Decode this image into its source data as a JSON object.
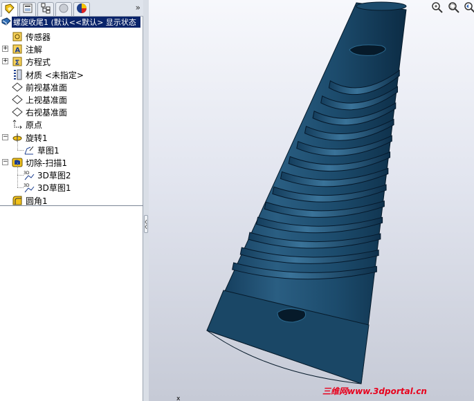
{
  "panel": {
    "tabs": [
      {
        "icon": "feature-manager-icon",
        "active": true
      },
      {
        "icon": "property-manager-icon",
        "active": false
      },
      {
        "icon": "configuration-manager-icon",
        "active": false
      },
      {
        "icon": "dimxpert-manager-icon",
        "active": false
      },
      {
        "icon": "display-manager-icon",
        "active": false
      }
    ],
    "more_glyph": "»",
    "root_label": "螺旋收尾1  (默认<<默认> 显示状态",
    "tree": [
      {
        "label": "传感器",
        "icon": "sensors-icon",
        "expandable": false
      },
      {
        "label": "注解",
        "icon": "annotations-icon",
        "expandable": true,
        "expander": "+"
      },
      {
        "label": "方程式",
        "icon": "equations-icon",
        "expandable": true,
        "expander": "+"
      },
      {
        "label": "材质 <未指定>",
        "icon": "material-icon",
        "expandable": false
      },
      {
        "label": "前视基准面",
        "icon": "plane-icon",
        "expandable": false
      },
      {
        "label": "上视基准面",
        "icon": "plane-icon",
        "expandable": false
      },
      {
        "label": "右视基准面",
        "icon": "plane-icon",
        "expandable": false
      },
      {
        "label": "原点",
        "icon": "origin-icon",
        "expandable": false
      },
      {
        "label": "旋转1",
        "icon": "revolve-icon",
        "expandable": true,
        "expander": "−"
      },
      {
        "label": "草图1",
        "icon": "sketch-icon",
        "expandable": false,
        "child": true
      },
      {
        "label": "切除-扫描1",
        "icon": "cut-sweep-icon",
        "expandable": true,
        "expander": "−"
      },
      {
        "label": "3D草图2",
        "icon": "3d-sketch-icon",
        "expandable": false,
        "child": true
      },
      {
        "label": "3D草图1",
        "icon": "3d-sketch-icon",
        "expandable": false,
        "child": true
      },
      {
        "label": "圆角1",
        "icon": "fillet-icon",
        "expandable": false
      }
    ]
  },
  "viewport": {
    "tools": [
      "zoom-to-fit-icon",
      "zoom-to-area-icon",
      "previous-view-icon"
    ],
    "watermark": "三维网www.3dportal.cn",
    "cursor_mark": "x",
    "colors": {
      "part": "#1b4a6b",
      "part_dark": "#0d2d44",
      "part_light": "#2f6588",
      "watermark": "#e8001c"
    }
  }
}
